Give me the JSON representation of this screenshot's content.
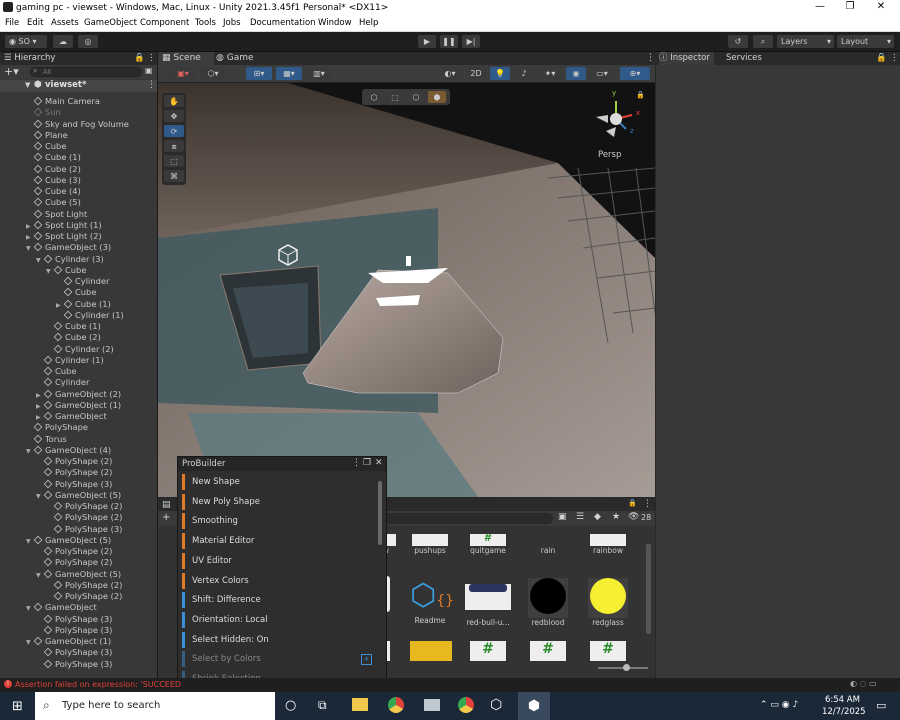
{
  "window": {
    "title": "gaming pc - viewset - Windows, Mac, Linux - Unity 2021.3.45f1 Personal* <DX11>",
    "minimize": "—",
    "maximize": "❐",
    "close": "✕"
  },
  "menu": [
    "File",
    "Edit",
    "Assets",
    "GameObject",
    "Component",
    "Tools",
    "Jobs",
    "Documentation",
    "Window",
    "Help"
  ],
  "toolbar": {
    "account": "SO",
    "layers": "Layers",
    "layout": "Layout"
  },
  "hierarchy": {
    "tab": "Hierarchy",
    "search_placeholder": "All",
    "scene_name": "viewset*",
    "items": [
      {
        "label": "Main Camera",
        "depth": 1,
        "arrow": ""
      },
      {
        "label": "Sun",
        "depth": 1,
        "arrow": "",
        "dim": true
      },
      {
        "label": "Sky and Fog Volume",
        "depth": 1,
        "arrow": ""
      },
      {
        "label": "Plane",
        "depth": 1,
        "arrow": ""
      },
      {
        "label": "Cube",
        "depth": 1,
        "arrow": ""
      },
      {
        "label": "Cube (1)",
        "depth": 1,
        "arrow": ""
      },
      {
        "label": "Cube (2)",
        "depth": 1,
        "arrow": ""
      },
      {
        "label": "Cube (3)",
        "depth": 1,
        "arrow": ""
      },
      {
        "label": "Cube (4)",
        "depth": 1,
        "arrow": ""
      },
      {
        "label": "Cube (5)",
        "depth": 1,
        "arrow": ""
      },
      {
        "label": "Spot Light",
        "depth": 1,
        "arrow": ""
      },
      {
        "label": "Spot Light (1)",
        "depth": 1,
        "arrow": "▶"
      },
      {
        "label": "Spot Light (2)",
        "depth": 1,
        "arrow": "▶"
      },
      {
        "label": "GameObject (3)",
        "depth": 1,
        "arrow": "▼"
      },
      {
        "label": "Cylinder (3)",
        "depth": 2,
        "arrow": "▼"
      },
      {
        "label": "Cube",
        "depth": 3,
        "arrow": "▼"
      },
      {
        "label": "Cylinder",
        "depth": 4,
        "arrow": ""
      },
      {
        "label": "Cube",
        "depth": 4,
        "arrow": ""
      },
      {
        "label": "Cube (1)",
        "depth": 4,
        "arrow": "▶"
      },
      {
        "label": "Cylinder (1)",
        "depth": 4,
        "arrow": ""
      },
      {
        "label": "Cube (1)",
        "depth": 3,
        "arrow": ""
      },
      {
        "label": "Cube (2)",
        "depth": 3,
        "arrow": ""
      },
      {
        "label": "Cylinder (2)",
        "depth": 3,
        "arrow": ""
      },
      {
        "label": "Cylinder (1)",
        "depth": 2,
        "arrow": ""
      },
      {
        "label": "Cube",
        "depth": 2,
        "arrow": ""
      },
      {
        "label": "Cylinder",
        "depth": 2,
        "arrow": ""
      },
      {
        "label": "GameObject (2)",
        "depth": 2,
        "arrow": "▶"
      },
      {
        "label": "GameObject (1)",
        "depth": 2,
        "arrow": "▶"
      },
      {
        "label": "GameObject",
        "depth": 2,
        "arrow": "▶"
      },
      {
        "label": "PolyShape",
        "depth": 1,
        "arrow": ""
      },
      {
        "label": "Torus",
        "depth": 1,
        "arrow": ""
      },
      {
        "label": "GameObject (4)",
        "depth": 1,
        "arrow": "▼"
      },
      {
        "label": "PolyShape (2)",
        "depth": 2,
        "arrow": ""
      },
      {
        "label": "PolyShape (2)",
        "depth": 2,
        "arrow": ""
      },
      {
        "label": "PolyShape (3)",
        "depth": 2,
        "arrow": ""
      },
      {
        "label": "GameObject (5)",
        "depth": 2,
        "arrow": "▼"
      },
      {
        "label": "PolyShape (2)",
        "depth": 3,
        "arrow": ""
      },
      {
        "label": "PolyShape (2)",
        "depth": 3,
        "arrow": ""
      },
      {
        "label": "PolyShape (3)",
        "depth": 3,
        "arrow": ""
      },
      {
        "label": "GameObject (5)",
        "depth": 1,
        "arrow": "▼"
      },
      {
        "label": "PolyShape (2)",
        "depth": 2,
        "arrow": ""
      },
      {
        "label": "PolyShape (2)",
        "depth": 2,
        "arrow": ""
      },
      {
        "label": "GameObject (5)",
        "depth": 2,
        "arrow": "▼"
      },
      {
        "label": "PolyShape (2)",
        "depth": 3,
        "arrow": ""
      },
      {
        "label": "PolyShape (2)",
        "depth": 3,
        "arrow": ""
      },
      {
        "label": "GameObject",
        "depth": 1,
        "arrow": "▼"
      },
      {
        "label": "PolyShape (3)",
        "depth": 2,
        "arrow": ""
      },
      {
        "label": "PolyShape (3)",
        "depth": 2,
        "arrow": ""
      },
      {
        "label": "GameObject (1)",
        "depth": 1,
        "arrow": "▼"
      },
      {
        "label": "PolyShape (3)",
        "depth": 2,
        "arrow": ""
      },
      {
        "label": "PolyShape (3)",
        "depth": 2,
        "arrow": ""
      }
    ]
  },
  "scene": {
    "tab_scene": "Scene",
    "tab_game": "Game",
    "mode_2d": "2D",
    "persp": "Persp",
    "axis_y": "y",
    "axis_x": "x",
    "axis_z": "z"
  },
  "inspector": {
    "tab_inspector": "Inspector",
    "tab_services": "Services"
  },
  "probuilder": {
    "title": "ProBuilder",
    "items": [
      {
        "label": "New Shape",
        "color": "#e07a26"
      },
      {
        "label": "New Poly Shape",
        "color": "#e07a26"
      },
      {
        "label": "Smoothing",
        "color": "#e07a26"
      },
      {
        "label": "Material Editor",
        "color": "#e07a26"
      },
      {
        "label": "UV Editor",
        "color": "#e07a26"
      },
      {
        "label": "Vertex Colors",
        "color": "#e07a26"
      },
      {
        "label": "Shift: Difference",
        "color": "#3a8fd6"
      },
      {
        "label": "Orientation: Local",
        "color": "#3a8fd6"
      },
      {
        "label": "Select Hidden: On",
        "color": "#3a8fd6"
      },
      {
        "label": "Select by Colors",
        "color": "#3a8fd6",
        "dim": true
      },
      {
        "label": "Shrink Selection",
        "color": "#3a8fd6",
        "dim": true
      }
    ]
  },
  "project": {
    "count": "28",
    "row1": [
      "w",
      "pushups",
      "quitgame",
      "rain",
      "rainbow"
    ],
    "row2": [
      "Readme",
      "red-bull-u...",
      "redblood",
      "redglass"
    ]
  },
  "status": {
    "message": "Assertion failed on expression: 'SUCCEED"
  },
  "taskbar": {
    "search_placeholder": "Type here to search",
    "time": "6:54 AM",
    "date": "12/7/2025"
  },
  "colors": {
    "accent": "#3a79bb",
    "orange": "#e07a26",
    "blue": "#3a8fd6",
    "error": "#e0413a"
  }
}
